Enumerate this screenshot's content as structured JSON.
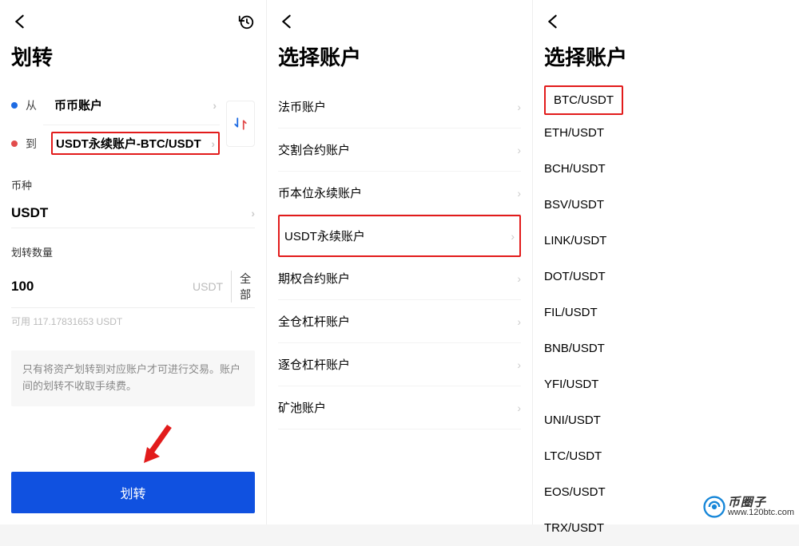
{
  "panel1": {
    "title": "划转",
    "from_label": "从",
    "to_label": "到",
    "from_account": "币币账户",
    "to_account": "USDT永续账户-BTC/USDT",
    "coin_label": "币种",
    "coin_value": "USDT",
    "amount_label": "划转数量",
    "amount_value": "100",
    "amount_unit": "USDT",
    "all_btn": "全部",
    "available": "可用 117.17831653 USDT",
    "note": "只有将资产划转到对应账户才可进行交易。账户间的划转不收取手续费。",
    "submit": "划转"
  },
  "panel2": {
    "title": "选择账户",
    "items": [
      "法币账户",
      "交割合约账户",
      "币本位永续账户",
      "USDT永续账户",
      "期权合约账户",
      "全仓杠杆账户",
      "逐仓杠杆账户",
      "矿池账户"
    ]
  },
  "panel3": {
    "title": "选择账户",
    "items": [
      "BTC/USDT",
      "ETH/USDT",
      "BCH/USDT",
      "BSV/USDT",
      "LINK/USDT",
      "DOT/USDT",
      "FIL/USDT",
      "BNB/USDT",
      "YFI/USDT",
      "UNI/USDT",
      "LTC/USDT",
      "EOS/USDT",
      "TRX/USDT"
    ]
  },
  "watermark": {
    "brand": "币圈子",
    "url": "www.120btc.com"
  }
}
